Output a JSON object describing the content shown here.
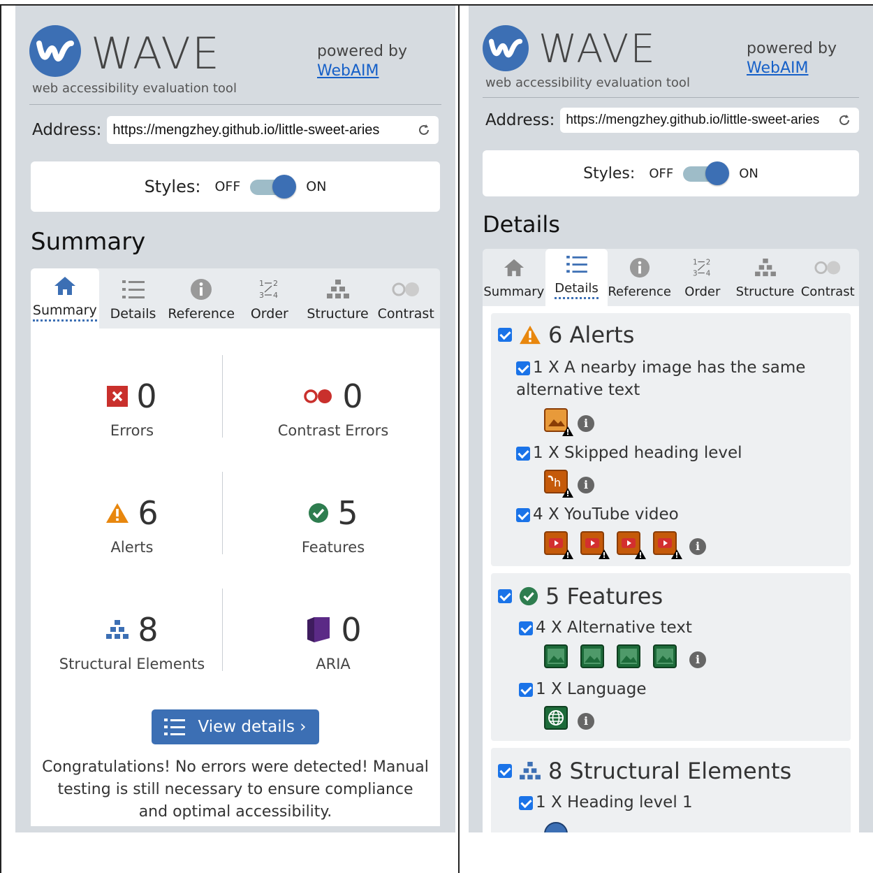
{
  "brand": {
    "name": "WAVE",
    "tagline": "web accessibility evaluation tool",
    "powered_by": "powered by",
    "webaim_link": "WebAIM"
  },
  "address": {
    "label": "Address:",
    "value": "https://mengzhey.github.io/little-sweet-aries"
  },
  "styles": {
    "label": "Styles:",
    "off": "OFF",
    "on": "ON",
    "state": "on"
  },
  "tabs": [
    "Summary",
    "Details",
    "Reference",
    "Order",
    "Structure",
    "Contrast"
  ],
  "left": {
    "section_title": "Summary",
    "active_tab": "Summary",
    "stats": [
      {
        "value": "0",
        "label": "Errors",
        "icon": "error-icon"
      },
      {
        "value": "0",
        "label": "Contrast Errors",
        "icon": "contrast-icon"
      },
      {
        "value": "6",
        "label": "Alerts",
        "icon": "alert-icon"
      },
      {
        "value": "5",
        "label": "Features",
        "icon": "feature-icon"
      },
      {
        "value": "8",
        "label": "Structural Elements",
        "icon": "structure-icon"
      },
      {
        "value": "0",
        "label": "ARIA",
        "icon": "aria-icon"
      }
    ],
    "view_details": "View details ›",
    "congrats": "Congratulations! No errors were detected! Manual testing is still necessary to ensure compliance and optimal accessibility."
  },
  "right": {
    "section_title": "Details",
    "active_tab": "Details",
    "alerts": {
      "title": "6 Alerts",
      "items": [
        {
          "text": "1 X A nearby image has the same alternative text"
        },
        {
          "text": "1 X Skipped heading level"
        },
        {
          "text": "4 X YouTube video"
        }
      ]
    },
    "features": {
      "title": "5 Features",
      "items": [
        {
          "text": "4 X Alternative text"
        },
        {
          "text": "1 X Language"
        }
      ]
    },
    "structure": {
      "title": "8 Structural Elements",
      "items": [
        {
          "text": "1 X Heading level 1"
        }
      ]
    }
  },
  "colors": {
    "panel_bg": "#d6dbe0",
    "brand_blue": "#3c6fb4",
    "link": "#1660c8",
    "error_red": "#c9302c",
    "alert_orange": "#e8870e",
    "feature_green": "#2e7d4f",
    "aria_purple": "#5b2a86"
  }
}
